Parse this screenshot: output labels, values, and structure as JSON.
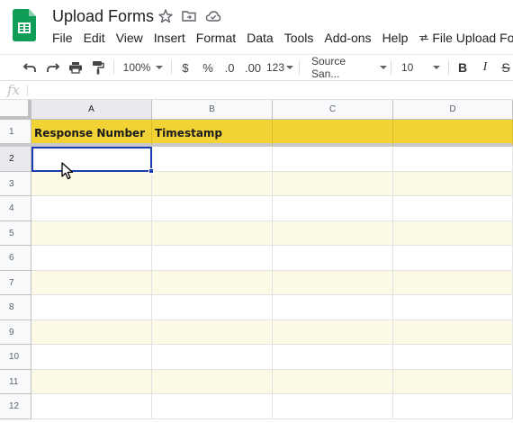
{
  "app": {
    "title": "Upload Forms",
    "brand_color": "#0f9d58"
  },
  "menu": [
    {
      "label": "File"
    },
    {
      "label": "Edit"
    },
    {
      "label": "View"
    },
    {
      "label": "Insert"
    },
    {
      "label": "Format"
    },
    {
      "label": "Data"
    },
    {
      "label": "Tools"
    },
    {
      "label": "Add-ons"
    },
    {
      "label": "Help"
    }
  ],
  "addon_link": {
    "label": "File Upload Forms",
    "icon": "arrow-icon"
  },
  "toolbar": {
    "zoom": "100%",
    "currency": "$",
    "percent": "%",
    "decrease_decimals": ".0",
    "increase_decimals": ".00",
    "more_formats": "123",
    "font": "Source San...",
    "font_size": "10",
    "bold": "B",
    "italic": "I",
    "strikethrough": "S"
  },
  "formula_bar": {
    "fx": "fx",
    "value": ""
  },
  "columns": [
    {
      "label": "A",
      "active": true
    },
    {
      "label": "B",
      "active": false
    },
    {
      "label": "C",
      "active": false
    },
    {
      "label": "D",
      "active": false
    }
  ],
  "rows": [
    {
      "num": "1",
      "cells": [
        "Response Number",
        "Timestamp",
        "",
        ""
      ]
    },
    {
      "num": "2",
      "cells": [
        "",
        "",
        "",
        ""
      ]
    },
    {
      "num": "3",
      "cells": [
        "",
        "",
        "",
        ""
      ]
    },
    {
      "num": "4",
      "cells": [
        "",
        "",
        "",
        ""
      ]
    },
    {
      "num": "5",
      "cells": [
        "",
        "",
        "",
        ""
      ]
    },
    {
      "num": "6",
      "cells": [
        "",
        "",
        "",
        ""
      ]
    },
    {
      "num": "7",
      "cells": [
        "",
        "",
        "",
        ""
      ]
    },
    {
      "num": "8",
      "cells": [
        "",
        "",
        "",
        ""
      ]
    },
    {
      "num": "9",
      "cells": [
        "",
        "",
        "",
        ""
      ]
    },
    {
      "num": "10",
      "cells": [
        "",
        "",
        "",
        ""
      ]
    },
    {
      "num": "11",
      "cells": [
        "",
        "",
        "",
        ""
      ]
    },
    {
      "num": "12",
      "cells": [
        "",
        "",
        "",
        ""
      ]
    }
  ],
  "selected_cell": "A2",
  "colors": {
    "header_fill": "#f2d335",
    "band_fill": "#fcfae6",
    "selection": "#1a3cb0"
  }
}
